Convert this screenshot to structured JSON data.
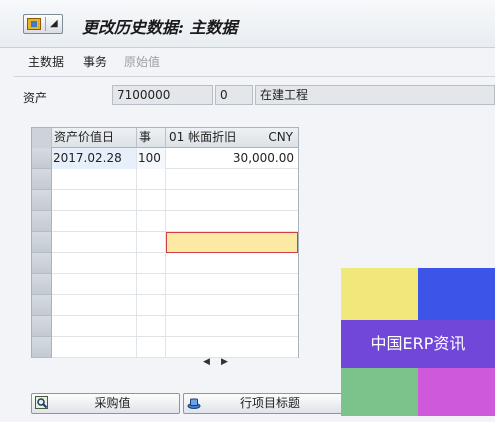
{
  "window": {
    "title": "更改历史数据: 主数据"
  },
  "menu": {
    "items": [
      "主数据",
      "事务",
      "原始值"
    ]
  },
  "header": {
    "asset_label": "资产",
    "asset_number": "7100000",
    "sub_number": "0",
    "asset_description": "在建工程"
  },
  "grid": {
    "columns": {
      "date": "资产价值日",
      "transaction": "事",
      "book_depreciation": "01 帐面折旧",
      "currency": "CNY"
    },
    "rows": [
      {
        "date": "2017.02.28",
        "transaction": "100",
        "amount": "30,000.00"
      },
      {
        "date": "",
        "transaction": "",
        "amount": ""
      },
      {
        "date": "",
        "transaction": "",
        "amount": ""
      },
      {
        "date": "",
        "transaction": "",
        "amount": ""
      },
      {
        "date": "",
        "transaction": "",
        "amount": ""
      },
      {
        "date": "",
        "transaction": "",
        "amount": ""
      },
      {
        "date": "",
        "transaction": "",
        "amount": ""
      },
      {
        "date": "",
        "transaction": "",
        "amount": ""
      },
      {
        "date": "",
        "transaction": "",
        "amount": ""
      },
      {
        "date": "",
        "transaction": "",
        "amount": ""
      }
    ],
    "scroll_left": "◀",
    "scroll_right": "▶"
  },
  "buttons": {
    "purchase_value": "采购值",
    "line_item_header": "行项目标题"
  },
  "watermark": {
    "text": "中国ERP资讯",
    "colors": [
      "#f0e87a",
      "#3c55e8",
      "#7047d8",
      "#7cc38b",
      "#cf59db"
    ]
  },
  "icons": {
    "system": "system-menu-icon",
    "purchase": "magnifier-icon",
    "line_item": "hat-icon"
  }
}
